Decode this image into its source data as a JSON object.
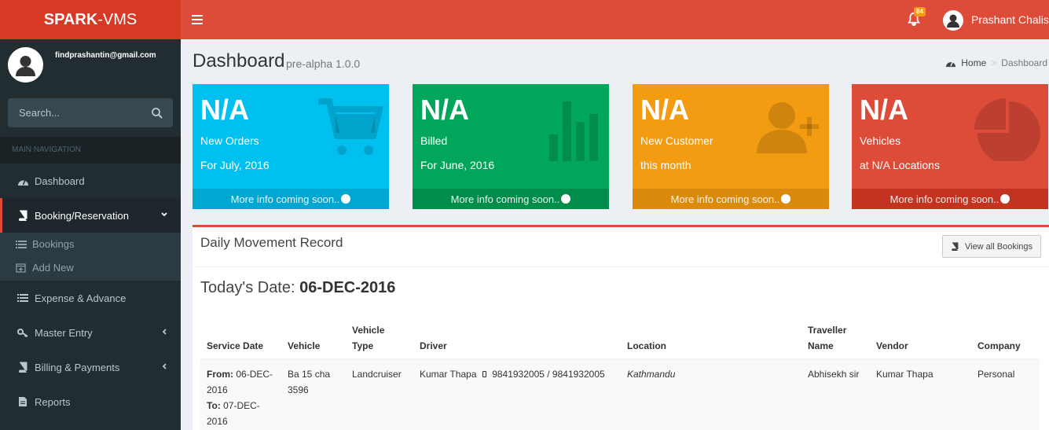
{
  "app": {
    "logo_bold": "SPARK",
    "logo_rest": "-VMS"
  },
  "header": {
    "notification_count": "84",
    "user_name": "Prashant Chalise"
  },
  "sidebar": {
    "email": "findprashantin@gmail.com",
    "search_placeholder": "Search...",
    "nav_header": "MAIN NAVIGATION",
    "items": [
      {
        "label": "Dashboard"
      },
      {
        "label": "Booking/Reservation"
      },
      {
        "label": "Expense & Advance"
      },
      {
        "label": "Master Entry"
      },
      {
        "label": "Billing & Payments"
      },
      {
        "label": "Reports"
      }
    ],
    "subitems": [
      {
        "label": "Bookings"
      },
      {
        "label": "Add New"
      }
    ]
  },
  "page": {
    "title": "Dashboard",
    "subtitle": "pre-alpha 1.0.0",
    "breadcrumb": {
      "home": "Home",
      "current": "Dashboard"
    }
  },
  "boxes": [
    {
      "value": "N/A",
      "label1": "New Orders",
      "label2": "For July, 2016",
      "footer": "More info coming soon..",
      "color": "#00c0ef",
      "icon": "shopping-cart-icon"
    },
    {
      "value": "N/A",
      "label1": "Billed",
      "label2": "For June, 2016",
      "footer": "More info coming soon..",
      "color": "#00a65a",
      "icon": "bar-chart-icon"
    },
    {
      "value": "N/A",
      "label1": "New Customer",
      "label2": "this month",
      "footer": "More info coming soon..",
      "color": "#f39c12",
      "icon": "user-plus-icon"
    },
    {
      "value": "N/A",
      "label1": "Vehicles",
      "label2": "at N/A Locations",
      "footer": "More info coming soon..",
      "color": "#dd4b39",
      "icon": "pie-chart-icon"
    }
  ],
  "panel": {
    "title": "Daily Movement Record",
    "view_button": "View all Bookings",
    "today_label": "Today's Date:",
    "today_value": "06-DEC-2016"
  },
  "table": {
    "headers": [
      "Service Date",
      "Vehicle",
      "Vehicle Type",
      "Driver",
      "Location",
      "Traveller Name",
      "Vendor",
      "Company"
    ],
    "rows": [
      {
        "from_label": "From:",
        "from_date": "06-DEC-2016",
        "to_label": "To:",
        "to_date": "07-DEC-2016",
        "vehicle": "Ba 15 cha 3596",
        "vehicle_type": "Landcruiser",
        "driver": "Kumar Thapa",
        "driver_phone": "9841932005 / 9841932005",
        "location": "Kathmandu",
        "traveller": "Abhisekh sir",
        "vendor": "Kumar Thapa",
        "company": "Personal"
      }
    ]
  },
  "colors": {
    "header": "#dd4b39",
    "logo": "#d73925",
    "sidebar": "#222d32"
  }
}
